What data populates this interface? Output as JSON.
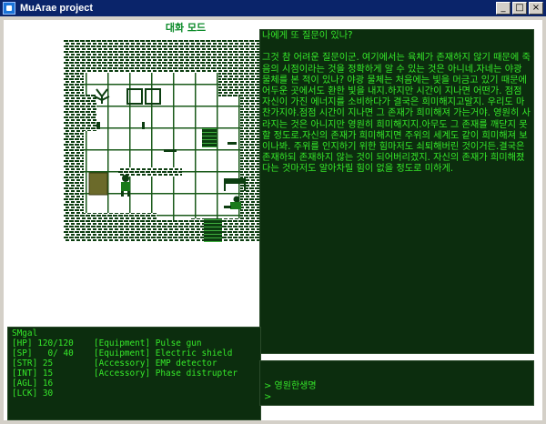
{
  "window": {
    "title": "MuArae project",
    "buttons": {
      "minimize": "_",
      "maximize": "□",
      "close": "×"
    }
  },
  "map": {
    "title": "대화 모드"
  },
  "dialogue": {
    "text": "나에게 또 질문이 있나?\n\n그것 참 어려운 질문이군. 여기에서는 육체가 존재하지 않기 때문에 죽음의 시점이라는 것을 정확하게 알 수 있는 것은 아니네.자네는 야광 물체를 본 적이 있나? 야광 물체는 처음에는 빛을 머금고 있기 때문에 어두운 곳에서도 환한 빛을 내지.하지만 시간이 지나면 어떤가. 점점 자신이 가진 에너지를 소비하다가 결국은 희미해지고말지. 우리도 마찬가지야.점점 시간이 지나면 그 존재가 희미해져 가는거야. 영원히 사라지는 것은 아니지만 영원히 희미해지지.아무도 그 존재를 깨닫지 못할 정도로.자신의 존재가 희미해지면 주위의 세계도 같이 희미해져 보이나봐. 주위를 인지하기 위한 힘마저도 쇠퇴해버린 것이거든.결국은 존재하되 존재하지 않는 것이 되어버리겠지. 자신의 존재가 희미해졌다는 것마저도 알아차릴 힘이 없을 정도로 미하게."
  },
  "stats": {
    "name": "SMgal",
    "rows": [
      {
        "label": "[HP] 120/120",
        "equip": "[Equipment] Pulse gun"
      },
      {
        "label": "[SP]   0/ 40",
        "equip": "[Equipment] Electric shield"
      },
      {
        "label": "[STR] 25",
        "equip": "[Accessory] EMP detector"
      },
      {
        "label": "[INT] 15",
        "equip": "[Accessory] Phase distrupter"
      },
      {
        "label": "[AGL] 16",
        "equip": ""
      },
      {
        "label": "[LCK] 30",
        "equip": ""
      }
    ]
  },
  "input": {
    "history": "> 영원한생명",
    "prompt": ">"
  },
  "colors": {
    "panel_bg": "#0c2d0e",
    "text": "#36e82a",
    "titlebar": "#0a246a"
  }
}
